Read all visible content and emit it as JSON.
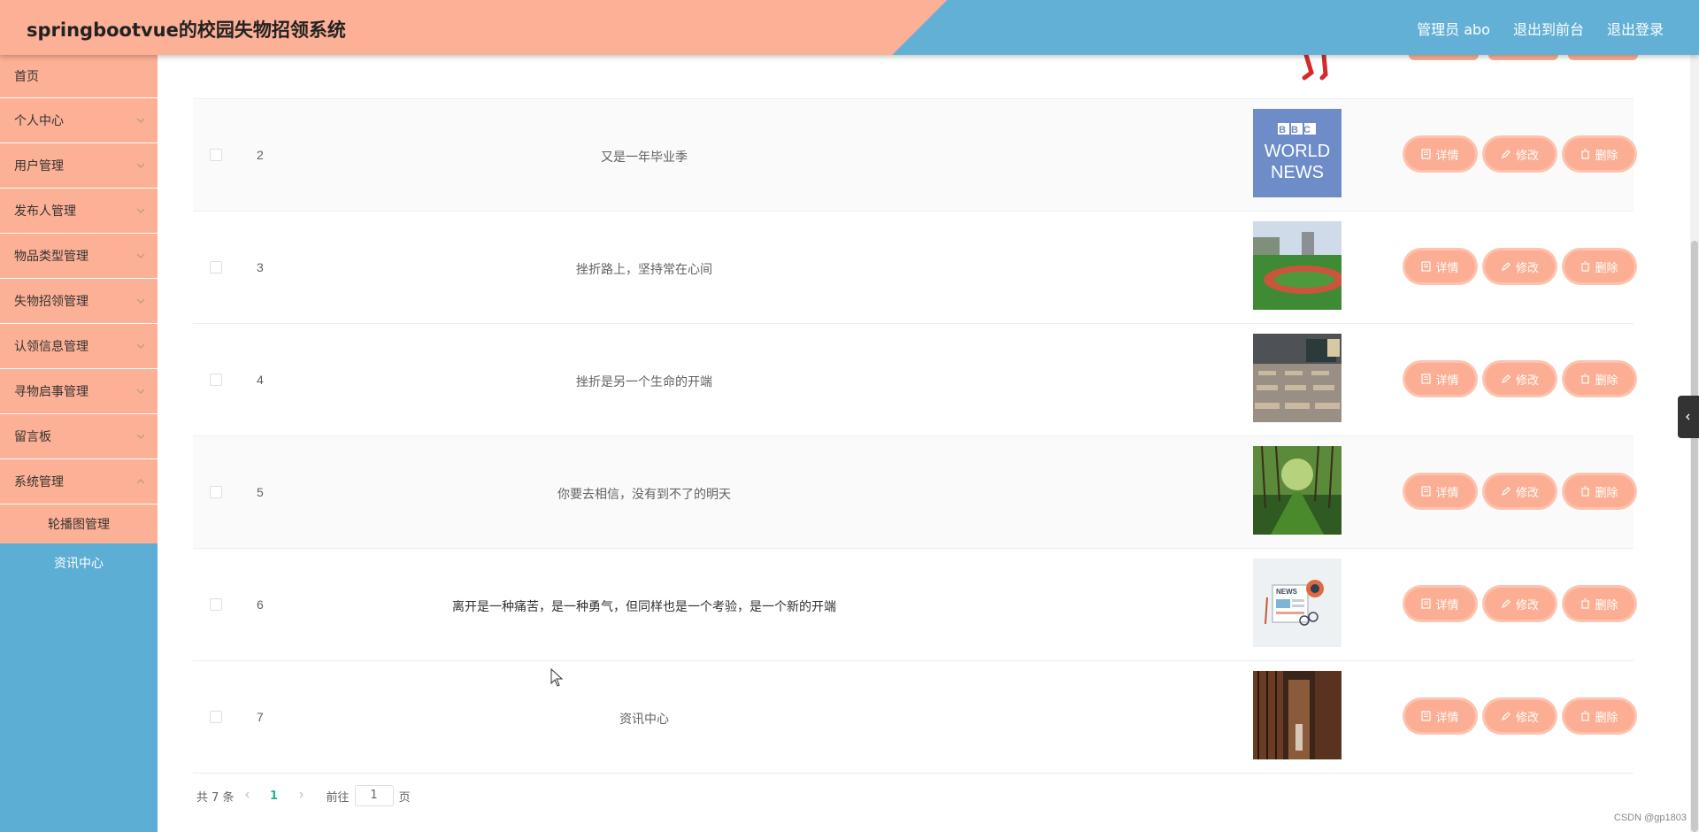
{
  "header": {
    "title": "springbootvue的校园失物招领系统",
    "links": [
      "管理员 abo",
      "退出到前台",
      "退出登录"
    ]
  },
  "sidebar": {
    "items": [
      {
        "label": "首页",
        "has_arrow": false
      },
      {
        "label": "个人中心",
        "has_arrow": true
      },
      {
        "label": "用户管理",
        "has_arrow": true
      },
      {
        "label": "发布人管理",
        "has_arrow": true
      },
      {
        "label": "物品类型管理",
        "has_arrow": true
      },
      {
        "label": "失物招领管理",
        "has_arrow": true
      },
      {
        "label": "认领信息管理",
        "has_arrow": true
      },
      {
        "label": "寻物启事管理",
        "has_arrow": true
      },
      {
        "label": "留言板",
        "has_arrow": true
      },
      {
        "label": "系统管理",
        "has_arrow": true
      }
    ],
    "sub_items": [
      "轮播图管理",
      "资讯中心"
    ],
    "active_sub": "资讯中心"
  },
  "table": {
    "rows": [
      {
        "index": "2",
        "title": "又是一年毕业季",
        "image": "bbc-world-news"
      },
      {
        "index": "3",
        "title": "挫折路上，坚持常在心间",
        "image": "campus-track"
      },
      {
        "index": "4",
        "title": "挫折是另一个生命的开端",
        "image": "classroom"
      },
      {
        "index": "5",
        "title": "你要去相信，没有到不了的明天",
        "image": "forest-path"
      },
      {
        "index": "6",
        "title": "离开是一种痛苦，是一种勇气，但同样也是一个考验，是一个新的开端",
        "image": "news-illustration"
      },
      {
        "index": "7",
        "title": "资讯中心",
        "image": "library-interior"
      }
    ],
    "actions": {
      "detail": "详情",
      "edit": "修改",
      "delete": "删除"
    },
    "thumb_texts": {
      "bbc_line1": "BBC",
      "bbc_line2": "WORLD",
      "bbc_line3": "NEWS",
      "news_label": "NEWS"
    }
  },
  "pagination": {
    "total": "共 7 条",
    "current_page": "1",
    "goto_label": "前往",
    "goto_value": "1",
    "page_suffix": "页"
  },
  "watermark": "CSDN @gp1803",
  "colors": {
    "primary": "#fcb095",
    "secondary": "#5caed4",
    "active_page": "#28b08d"
  }
}
